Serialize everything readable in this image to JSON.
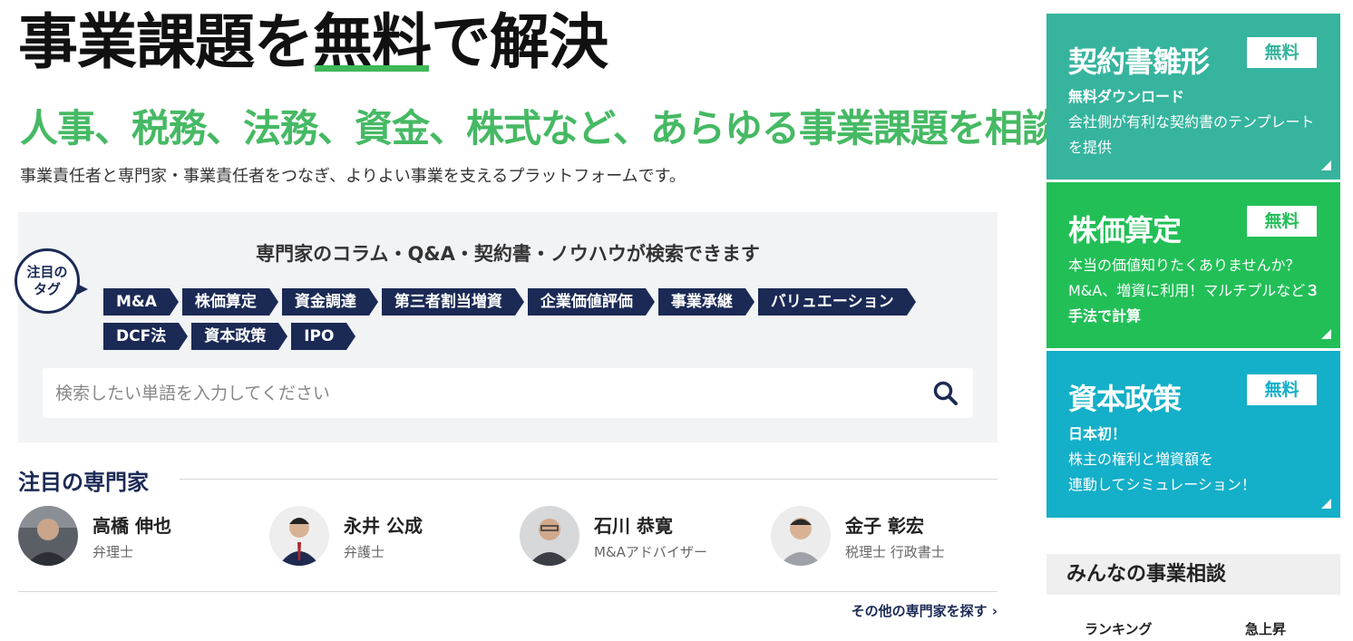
{
  "hero": {
    "title_part1": "事業課題を",
    "title_highlight": "無料",
    "title_part2": "で解決",
    "subtitle": "人事、税務、法務、資金、株式など、あらゆる事業課題を相談",
    "description": "事業責任者と専門家・事業責任者をつなぎ、よりよい事業を支えるプラットフォームです。"
  },
  "search": {
    "heading": "専門家のコラム・Q&A・契約書・ノウハウが検索できます",
    "badge_line1": "注目の",
    "badge_line2": "タグ",
    "tags": [
      "M&A",
      "株価算定",
      "資金調達",
      "第三者割当増資",
      "企業価値評価",
      "事業承継",
      "バリュエーション",
      "DCF法",
      "資本政策",
      "IPO"
    ],
    "placeholder": "検索したい単語を入力してください",
    "button_icon": "search-icon"
  },
  "experts": {
    "title": "注目の専門家",
    "items": [
      {
        "name": "高橋 伸也",
        "role": "弁理士"
      },
      {
        "name": "永井 公成",
        "role": "弁護士"
      },
      {
        "name": "石川 恭寛",
        "role": "M&Aアドバイザー"
      },
      {
        "name": "金子 彰宏",
        "role": "税理士 行政書士"
      }
    ],
    "more_link": "その他の専門家を探す"
  },
  "cards": [
    {
      "title": "契約書雛形",
      "badge": "無料",
      "bold_line": "無料ダウンロード",
      "text": "会社側が有利な契約書のテンプレートを提供",
      "color": "#36b49e"
    },
    {
      "title": "株価算定",
      "badge": "無料",
      "text": "本当の価値知りたくありませんか？M&A、増資に利用！マルチプルなど",
      "bold_tail": "３手法で計算",
      "color": "#22bf57"
    },
    {
      "title": "資本政策",
      "badge": "無料",
      "bold_line": "日本初！",
      "text1": "株主の権利と増資額を",
      "text2": "連動してシミュレーション！",
      "color": "#14afc8"
    }
  ],
  "consult": {
    "title": "みんなの事業相談",
    "tabs": [
      "ランキング",
      "急上昇"
    ]
  }
}
